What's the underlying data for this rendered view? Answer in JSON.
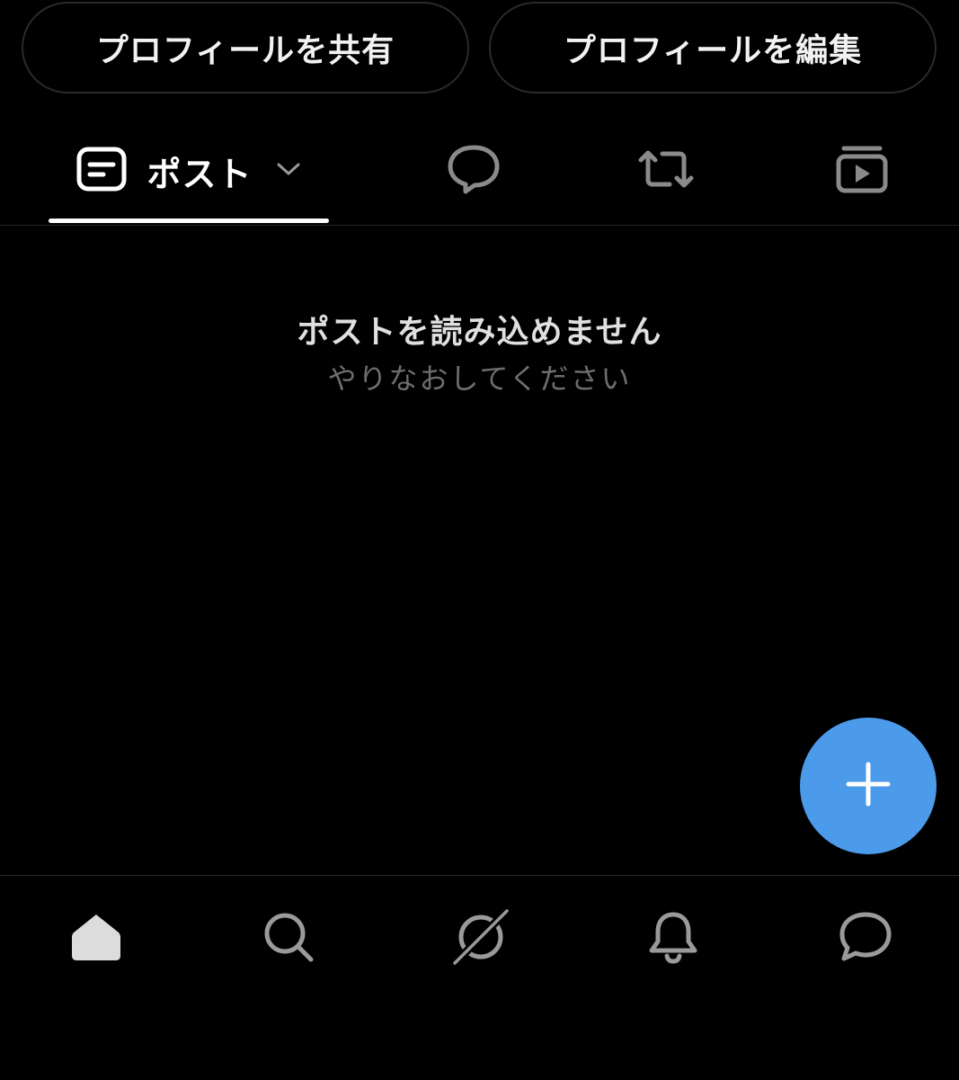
{
  "profile_actions": {
    "share_label": "プロフィールを共有",
    "edit_label": "プロフィールを編集"
  },
  "tabs": [
    {
      "label": "ポスト",
      "icon": "post-document-icon",
      "active": true,
      "has_dropdown": true
    },
    {
      "label": "",
      "icon": "reply-bubble-icon",
      "active": false
    },
    {
      "label": "",
      "icon": "repost-icon",
      "active": false
    },
    {
      "label": "",
      "icon": "media-video-icon",
      "active": false
    }
  ],
  "empty_state": {
    "title": "ポストを読み込めません",
    "subtitle": "やりなおしてください"
  },
  "fab": {
    "icon": "plus-icon",
    "color": "#4c9aea"
  },
  "bottom_nav": [
    {
      "icon": "home-icon",
      "active": true
    },
    {
      "icon": "search-icon",
      "active": false
    },
    {
      "icon": "explore-icon",
      "active": false
    },
    {
      "icon": "bell-icon",
      "active": false
    },
    {
      "icon": "chat-bubble-icon",
      "active": false
    }
  ],
  "colors": {
    "background": "#000000",
    "accent": "#4c9aea",
    "muted_text": "#6e6e6e",
    "inactive_icon": "#8a8a8a"
  }
}
